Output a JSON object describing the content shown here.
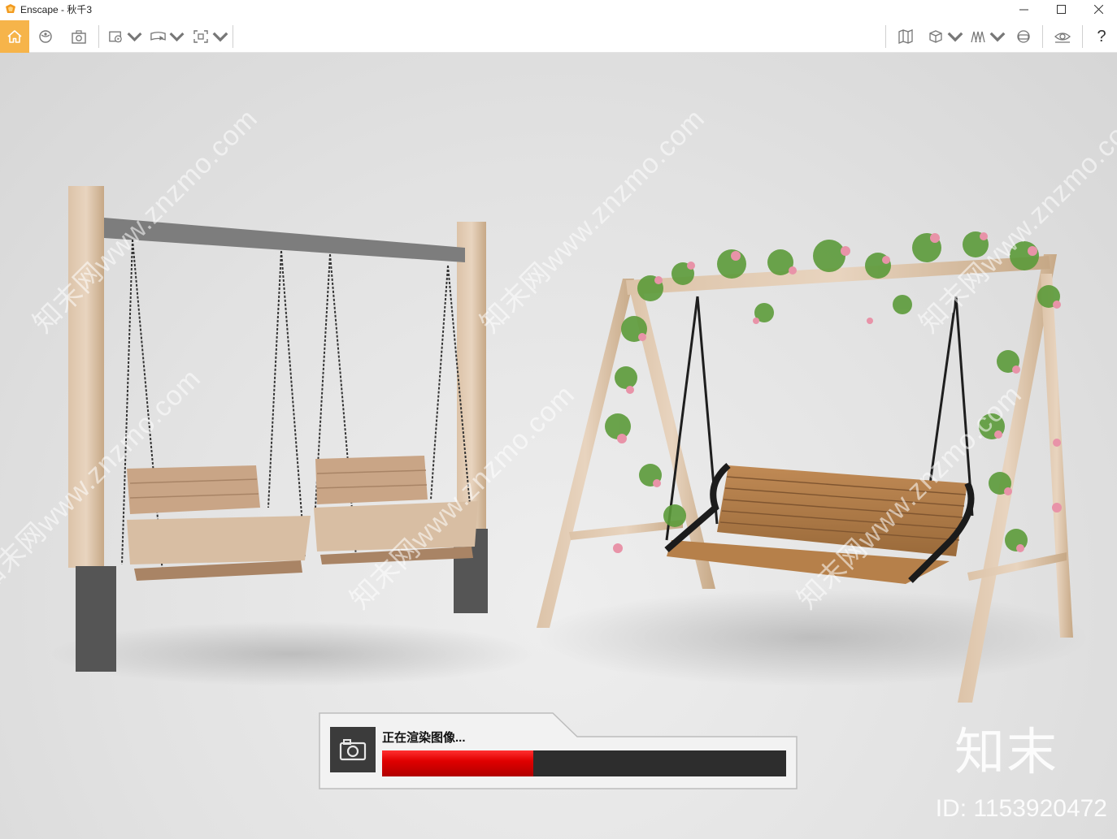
{
  "window": {
    "title": "Enscape - 秋千3",
    "controls": [
      "minimize-icon",
      "maximize-icon",
      "close-icon"
    ]
  },
  "toolbar": {
    "left_icons": [
      "home-icon",
      "orbit-icon",
      "screenshot-icon",
      "render-video-icon",
      "render-panorama-icon",
      "batch-render-icon"
    ],
    "right_icons": [
      "map-icon",
      "view-cube-icon",
      "assets-icon",
      "vr-headset-icon",
      "visual-settings-icon",
      "help-icon"
    ],
    "help_label": "?",
    "accent_color": "#f6b44a"
  },
  "render_status": {
    "label": "正在渲染图像...",
    "progress": 0.375,
    "bar_color": "#e00000"
  },
  "watermark": {
    "text": "知末网www.znzmo.com",
    "brand": "知末",
    "id": "ID: 1153920472"
  }
}
